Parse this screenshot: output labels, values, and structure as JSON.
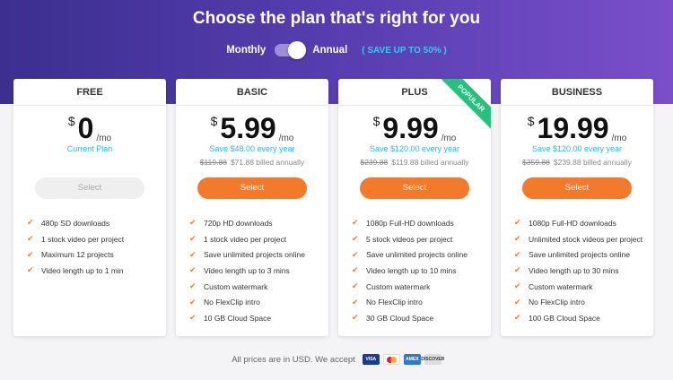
{
  "header": {
    "title": "Choose the plan that's right for you",
    "monthly_label": "Monthly",
    "annual_label": "Annual",
    "save_badge": "( SAVE UP TO 50% )"
  },
  "plans": [
    {
      "name": "FREE",
      "currency": "$",
      "price": "0",
      "per": "/mo",
      "note": "Current Plan",
      "old_price": "",
      "billed": "",
      "button": "Select",
      "features": [
        "480p SD downloads",
        "1 stock video per project",
        "Maximum 12 projects",
        "Video length up to 1 min"
      ]
    },
    {
      "name": "BASIC",
      "currency": "$",
      "price": "5.99",
      "per": "/mo",
      "note": "Save $48.00 every year",
      "old_price": "$119.88",
      "billed": "$71.88 billed annually",
      "button": "Select",
      "features": [
        "720p HD downloads",
        "1 stock video per project",
        "Save unlimited projects online",
        "Video length up to 3 mins",
        "Custom watermark",
        "No FlexClip intro",
        "10 GB Cloud Space"
      ]
    },
    {
      "name": "PLUS",
      "badge": "POPULAR",
      "currency": "$",
      "price": "9.99",
      "per": "/mo",
      "note": "Save $120.00 every year",
      "old_price": "$239.88",
      "billed": "$119.88 billed annually",
      "button": "Select",
      "features": [
        "1080p Full-HD downloads",
        "5 stock videos per project",
        "Save unlimited projects online",
        "Video length up to 10 mins",
        "Custom watermark",
        "No FlexClip intro",
        "30 GB Cloud Space"
      ]
    },
    {
      "name": "BUSINESS",
      "currency": "$",
      "price": "19.99",
      "per": "/mo",
      "note": "Save $120.00 every year",
      "old_price": "$359.88",
      "billed": "$239.88 billed annually",
      "button": "Select",
      "features": [
        "1080p Full-HD downloads",
        "Unlimited stock videos per project",
        "Save unlimited projects online",
        "Video length up to 30 mins",
        "Custom watermark",
        "No FlexClip intro",
        "100 GB Cloud Space"
      ]
    }
  ],
  "footer": {
    "text": "All prices are in USD. We accept",
    "cards": {
      "visa": "VISA",
      "mastercard": "",
      "amex": "AMEX",
      "discover": "DISCOVER"
    }
  },
  "colors": {
    "accent": "#f37a2a",
    "info": "#2fb6d8",
    "badge": "#27c07c",
    "hero": "#4b37a3"
  },
  "check_glyph": "✔"
}
